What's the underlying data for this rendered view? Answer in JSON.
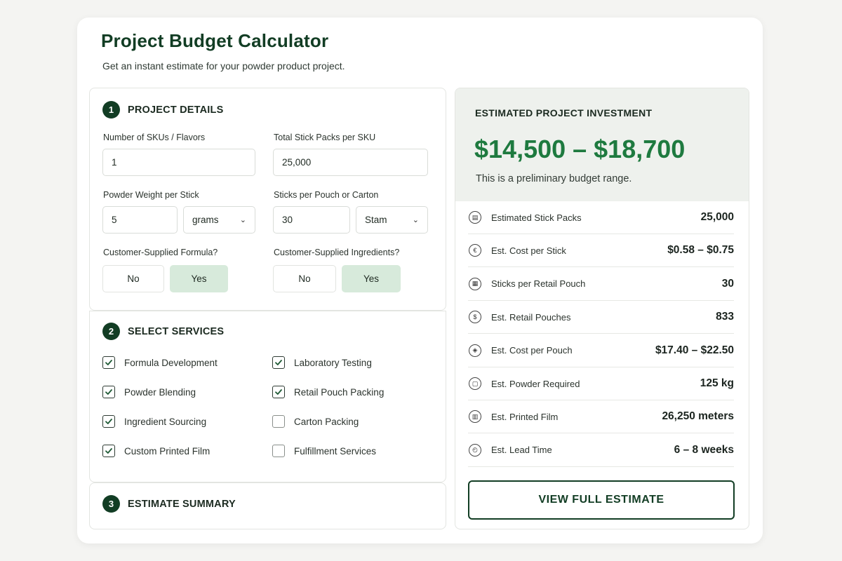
{
  "header": {
    "title": "Project Budget Calculator",
    "subtitle": "Get an instant estimate for your powder product project."
  },
  "details": {
    "step": "1",
    "title": "PROJECT DETAILS",
    "skus_label": "Number of SKUs / Flavors",
    "skus_value": "1",
    "packs_label": "Total Stick Packs per SKU",
    "packs_value": "25,000",
    "weight_label": "Powder Weight per Stick",
    "weight_value": "5",
    "weight_unit": "grams",
    "sticks_label": "Sticks per Pouch or Carton",
    "sticks_value": "30",
    "sticks_unit": "Stam",
    "formula_label": "Customer-Supplied Formula?",
    "ingredients_label": "Customer-Supplied Ingredients?",
    "no_label": "No",
    "yes_label": "Yes"
  },
  "services": {
    "step": "2",
    "title": "SELECT SERVICES",
    "items": [
      {
        "label": "Formula Development",
        "checked": true
      },
      {
        "label": "Powder Blending",
        "checked": true
      },
      {
        "label": "Ingredient Sourcing",
        "checked": true
      },
      {
        "label": "Custom Printed Film",
        "checked": true
      },
      {
        "label": "Laboratory Testing",
        "checked": true
      },
      {
        "label": "Retail Pouch Packing",
        "checked": true
      },
      {
        "label": "Carton Packing",
        "checked": false
      },
      {
        "label": "Fulfillment Services",
        "checked": false
      }
    ]
  },
  "summary": {
    "step": "3",
    "title": "ESTIMATE SUMMARY"
  },
  "investment": {
    "label": "ESTIMATED PROJECT INVESTMENT",
    "range": "$14,500 – $18,700",
    "note": "This is a preliminary budget range.",
    "accent_color": "#1e7a3f"
  },
  "metrics": [
    {
      "icon": "stick-pack-icon",
      "label": "Estimated Stick Packs",
      "value": "25,000"
    },
    {
      "icon": "cost-stick-icon",
      "label": "Est. Cost per Stick",
      "value": "$0.58 – $0.75"
    },
    {
      "icon": "pouch-count-icon",
      "label": "Sticks per Retail Pouch",
      "value": "30"
    },
    {
      "icon": "dollar-icon",
      "label": "Est. Retail Pouches",
      "value": "833"
    },
    {
      "icon": "pouch-cost-icon",
      "label": "Est. Cost per Pouch",
      "value": "$17.40 – $22.50"
    },
    {
      "icon": "powder-bag-icon",
      "label": "Est. Powder Required",
      "value": "125 kg"
    },
    {
      "icon": "film-roll-icon",
      "label": "Est. Printed Film",
      "value": "26,250 meters"
    },
    {
      "icon": "clock-icon",
      "label": "Est. Lead Time",
      "value": "6 – 8 weeks"
    }
  ],
  "cta_label": "VIEW FULL ESTIMATE"
}
